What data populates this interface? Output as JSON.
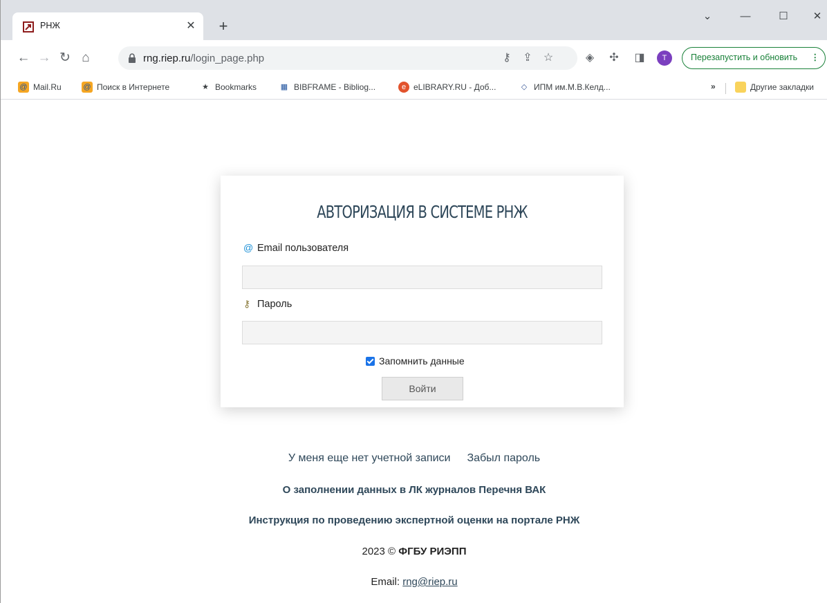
{
  "browser": {
    "tab": {
      "title": "РНЖ",
      "close": "✕"
    },
    "new_tab": "+",
    "window_controls": {
      "dropdown": "⌄",
      "minimize": "—",
      "maximize": "☐",
      "close": "✕"
    },
    "url": {
      "host": "rng.riep.ru",
      "path": "/login_page.php"
    },
    "update_button": "Перезапустить и обновить",
    "avatar_letter": "T",
    "bookmarks": [
      {
        "label": "Mail.Ru",
        "icon": "mailru-icon"
      },
      {
        "label": "Поиск в Интернете",
        "icon": "search-mail-icon"
      },
      {
        "label": "Bookmarks",
        "icon": "star-icon"
      },
      {
        "label": "BIBFRAME - Bibliog...",
        "icon": "bibframe-icon"
      },
      {
        "label": "eLIBRARY.RU - Доб...",
        "icon": "elibrary-icon"
      },
      {
        "label": "ИПМ им.М.В.Келд...",
        "icon": "ipm-icon"
      }
    ],
    "bookmarks_more": "»",
    "other_bookmarks": "Другие закладки",
    "accent_color": "#188038"
  },
  "login": {
    "title": "АВТОРИЗАЦИЯ В СИСТЕМЕ РНЖ",
    "email_label": "Email пользователя",
    "email_value": "",
    "password_label": "Пароль",
    "password_value": "",
    "remember_label": "Запомнить данные",
    "remember_checked": true,
    "submit_label": "Войти"
  },
  "links": {
    "register": "У меня еще нет учетной записи",
    "forgot": "Забыл пароль",
    "vak_info": "О заполнении данных в ЛК журналов Перечня ВАК",
    "expert_instruction": "Инструкция по проведению экспертной оценки на портале РНЖ"
  },
  "footer": {
    "year": "2023 ©",
    "org": "ФГБУ РИЭПП",
    "email_label": "Email:",
    "email": "rng@riep.ru"
  }
}
